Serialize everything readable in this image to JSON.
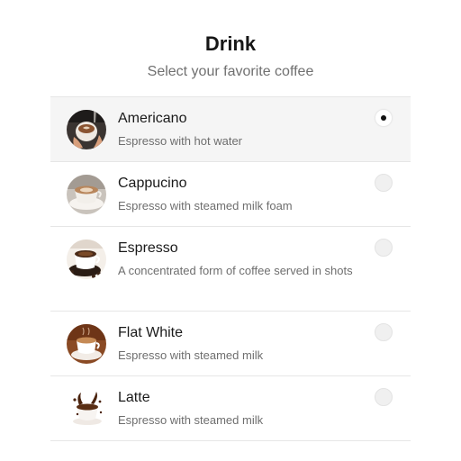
{
  "header": {
    "title": "Drink",
    "subtitle": "Select your favorite coffee"
  },
  "options": [
    {
      "name": "Americano",
      "description": "Espresso with hot water",
      "selected": true,
      "icon": "americano-photo"
    },
    {
      "name": "Cappucino",
      "description": "Espresso with steamed milk foam",
      "selected": false,
      "icon": "cappucino-photo"
    },
    {
      "name": "Espresso",
      "description": "A concentrated form of coffee served in shots",
      "selected": false,
      "icon": "espresso-photo"
    },
    {
      "name": "Flat White",
      "description": "Espresso with steamed milk",
      "selected": false,
      "icon": "flat-white-photo"
    },
    {
      "name": "Latte",
      "description": "Espresso with steamed milk",
      "selected": false,
      "icon": "latte-photo"
    }
  ],
  "colors": {
    "selected_row": "#f5f5f5",
    "divider": "#e6e6e6",
    "radio_dot": "#111111"
  }
}
